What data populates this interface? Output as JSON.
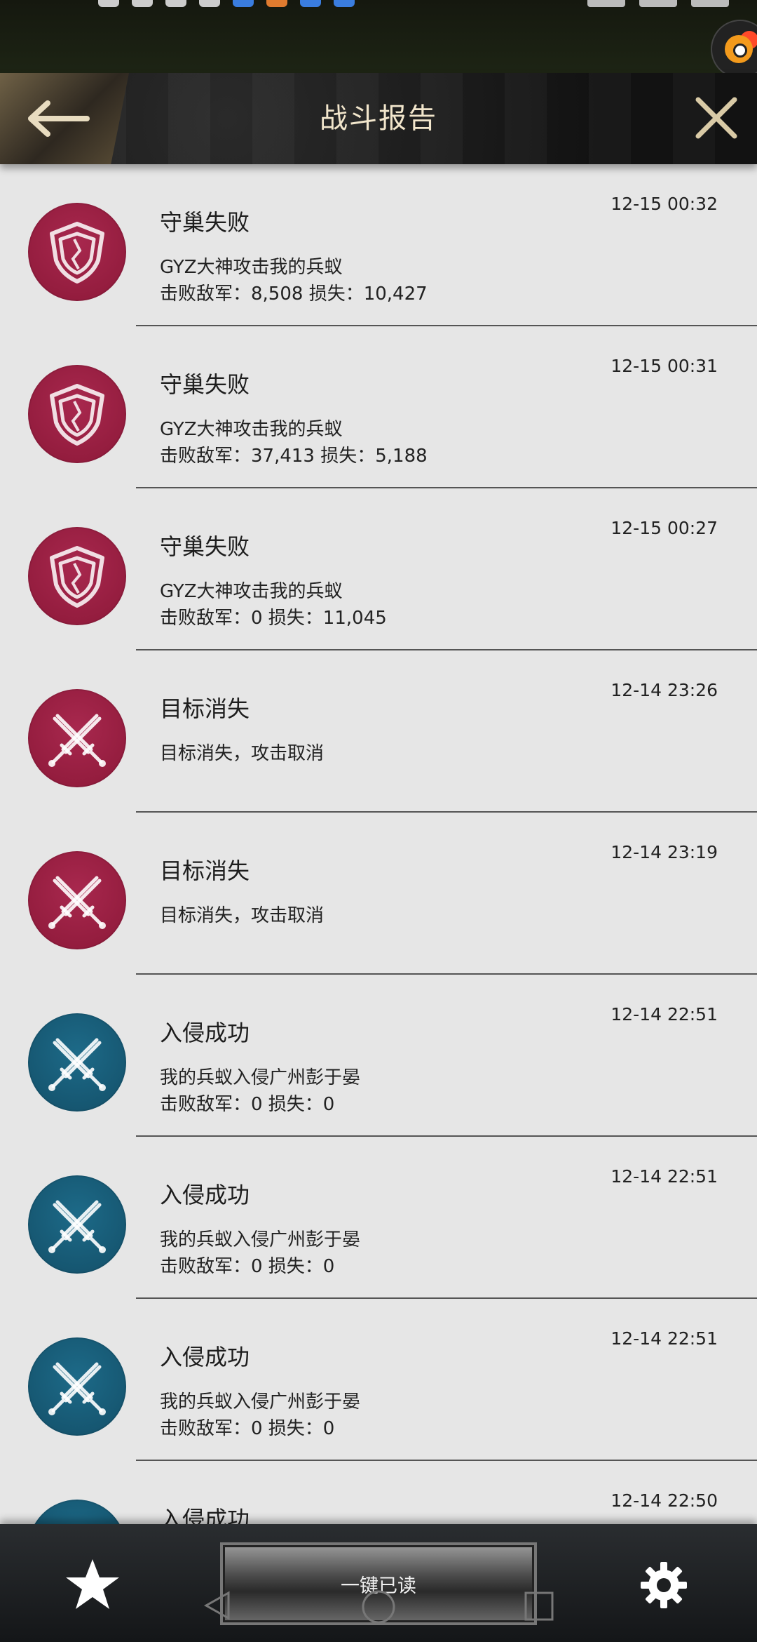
{
  "header": {
    "title": "战斗报告"
  },
  "colors": {
    "red_icon": "#9a1f44",
    "blue_icon": "#18607e",
    "title_text": "#f2e6cc",
    "header_bg": "#1a1a1a"
  },
  "reports": [
    {
      "type": "defense",
      "color": "red",
      "icon": "shield-icon",
      "title": "守巢失败",
      "time": "12-15 00:32",
      "line1": "GYZ大神攻击我的兵蚁",
      "line2": "击败敌军：8,508 损失：10,427"
    },
    {
      "type": "defense",
      "color": "red",
      "icon": "shield-icon",
      "title": "守巢失败",
      "time": "12-15 00:31",
      "line1": "GYZ大神攻击我的兵蚁",
      "line2": "击败敌军：37,413 损失：5,188"
    },
    {
      "type": "defense",
      "color": "red",
      "icon": "shield-icon",
      "title": "守巢失败",
      "time": "12-15 00:27",
      "line1": "GYZ大神攻击我的兵蚁",
      "line2": "击败敌军：0 损失：11,045"
    },
    {
      "type": "attack",
      "color": "red",
      "icon": "crossed-swords-icon",
      "title": "目标消失",
      "time": "12-14 23:26",
      "line1": "目标消失，攻击取消",
      "line2": ""
    },
    {
      "type": "attack",
      "color": "red",
      "icon": "crossed-swords-icon",
      "title": "目标消失",
      "time": "12-14 23:19",
      "line1": "目标消失，攻击取消",
      "line2": ""
    },
    {
      "type": "attack",
      "color": "blue",
      "icon": "crossed-swords-icon",
      "title": "入侵成功",
      "time": "12-14 22:51",
      "line1": "我的兵蚁入侵广州彭于晏",
      "line2": "击败敌军：0 损失：0"
    },
    {
      "type": "attack",
      "color": "blue",
      "icon": "crossed-swords-icon",
      "title": "入侵成功",
      "time": "12-14 22:51",
      "line1": "我的兵蚁入侵广州彭于晏",
      "line2": "击败敌军：0 损失：0"
    },
    {
      "type": "attack",
      "color": "blue",
      "icon": "crossed-swords-icon",
      "title": "入侵成功",
      "time": "12-14 22:51",
      "line1": "我的兵蚁入侵广州彭于晏",
      "line2": "击败敌军：0 损失：0"
    },
    {
      "type": "attack",
      "color": "blue",
      "icon": "crossed-swords-icon",
      "title": "入侵成功",
      "time": "12-14 22:50",
      "line1": "",
      "line2": ""
    }
  ],
  "bottom_bar": {
    "read_all_label": "一键已读",
    "left_icon": "star-icon",
    "right_icon": "gear-icon"
  }
}
